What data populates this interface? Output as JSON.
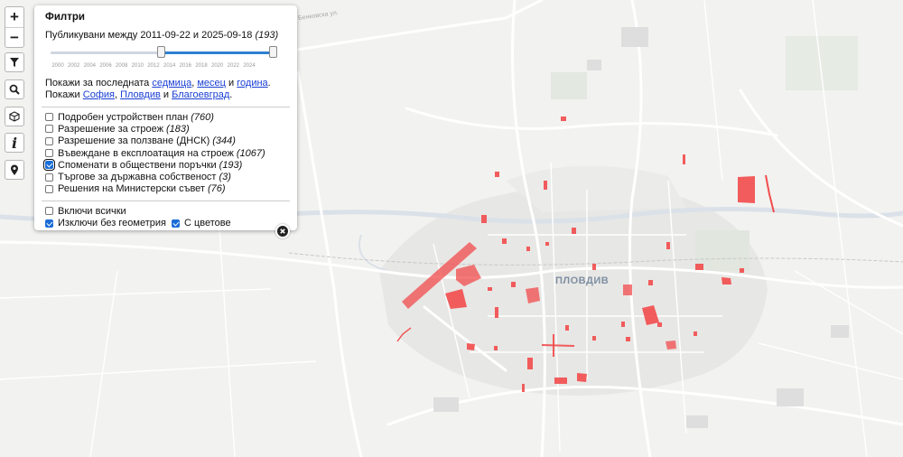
{
  "map": {
    "city_label": "ПЛОВДИВ",
    "road_label": "Бенковска ул.",
    "highlight_color": "#f23b3b",
    "road_color": "#ffffff",
    "water_color": "#dde3ea"
  },
  "controls": {
    "zoom_in": "+",
    "zoom_out": "−",
    "filter_icon": "funnel-icon",
    "search_icon": "magnifier-icon",
    "layers_icon": "cube-icon",
    "info_icon": "info-icon",
    "locate_icon": "map-pin-icon",
    "info_glyph": "i"
  },
  "panel": {
    "title": "Филтри",
    "range": {
      "prefix": "Публикувани между",
      "from": "2011-09-22",
      "conj": "и",
      "to": "2025-09-18",
      "count": "(193)",
      "ticks": [
        "2000",
        "2002",
        "2004",
        "2006",
        "2008",
        "2010",
        "2012",
        "2014",
        "2016",
        "2018",
        "2020",
        "2022",
        "2024"
      ]
    },
    "recent": {
      "prefix": "Покажи за последната",
      "week": "седмица",
      "comma": ",",
      "month": "месец",
      "and": "и",
      "year": "година",
      "dot": "."
    },
    "cities": {
      "prefix": "Покажи",
      "sofia": "София",
      "comma": ",",
      "plovdiv": "Пловдив",
      "and": "и",
      "blagoevgrad": "Благоевград",
      "dot": "."
    },
    "categories": [
      {
        "label": "Подробен устройствен план",
        "count": "(760)",
        "checked": false
      },
      {
        "label": "Разрешение за строеж",
        "count": "(183)",
        "checked": false
      },
      {
        "label": "Разрешение за ползване (ДНСК)",
        "count": "(344)",
        "checked": false
      },
      {
        "label": "Въвеждане в експлоатация на строеж",
        "count": "(1067)",
        "checked": false
      },
      {
        "label": "Споменати в обществени поръчки",
        "count": "(193)",
        "checked": true
      },
      {
        "label": "Търгове за държавна собственост",
        "count": "(3)",
        "checked": false
      },
      {
        "label": "Решения на Министерски съвет",
        "count": "(76)",
        "checked": false
      }
    ],
    "options": {
      "include_all": {
        "label": "Включи всички",
        "checked": false
      },
      "exclude_no_geometry": {
        "label": "Изключи без геометрия",
        "checked": true
      },
      "with_colors": {
        "label": "С цветове",
        "checked": true
      }
    }
  }
}
